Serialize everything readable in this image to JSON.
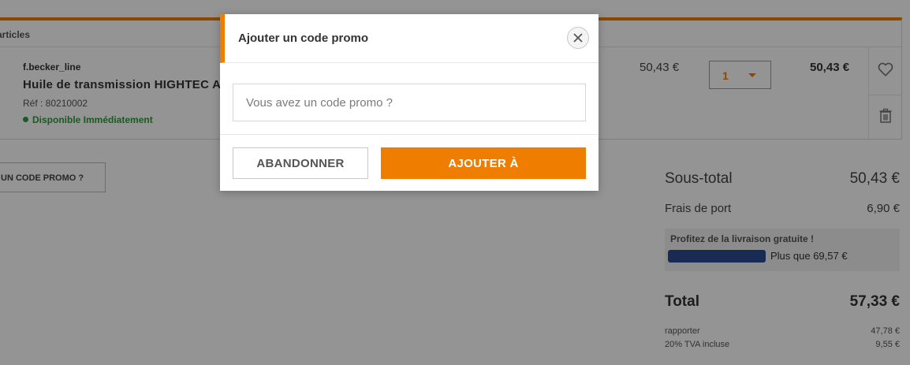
{
  "cart": {
    "header_label": "articles",
    "item": {
      "vendor": "f.becker_line",
      "name": "Huile de transmission HIGHTEC ATF",
      "ref": "Réf : 80210002",
      "availability": "Disponible Immédiatement",
      "unit_price": "50,43 €",
      "quantity": "1",
      "line_total": "50,43 €"
    },
    "icons": {
      "favorite": "heart-icon",
      "delete": "trash-icon"
    },
    "promo_link": "UN CODE PROMO ?"
  },
  "summary": {
    "subtotal_label": "Sous-total",
    "subtotal_value": "50,43 €",
    "shipping_label": "Frais de port",
    "shipping_value": "6,90 €",
    "free_shipping": {
      "title": "Profitez de la livraison gratuite !",
      "remaining": "Plus que 69,57 €"
    },
    "total_label": "Total",
    "total_value": "57,33 €",
    "net_label": "rapporter",
    "net_value": "47,78 €",
    "vat_label": "20% TVA incluse",
    "vat_value": "9,55 €"
  },
  "modal": {
    "title": "Ajouter un code promo",
    "input_placeholder": "Vous avez un code promo ?",
    "input_value": "",
    "cancel_label": "ABANDONNER",
    "submit_label": "AJOUTER À"
  },
  "colors": {
    "accent": "#ee7d00",
    "available": "#2e9a3c",
    "progress": "#2a4a8f"
  }
}
